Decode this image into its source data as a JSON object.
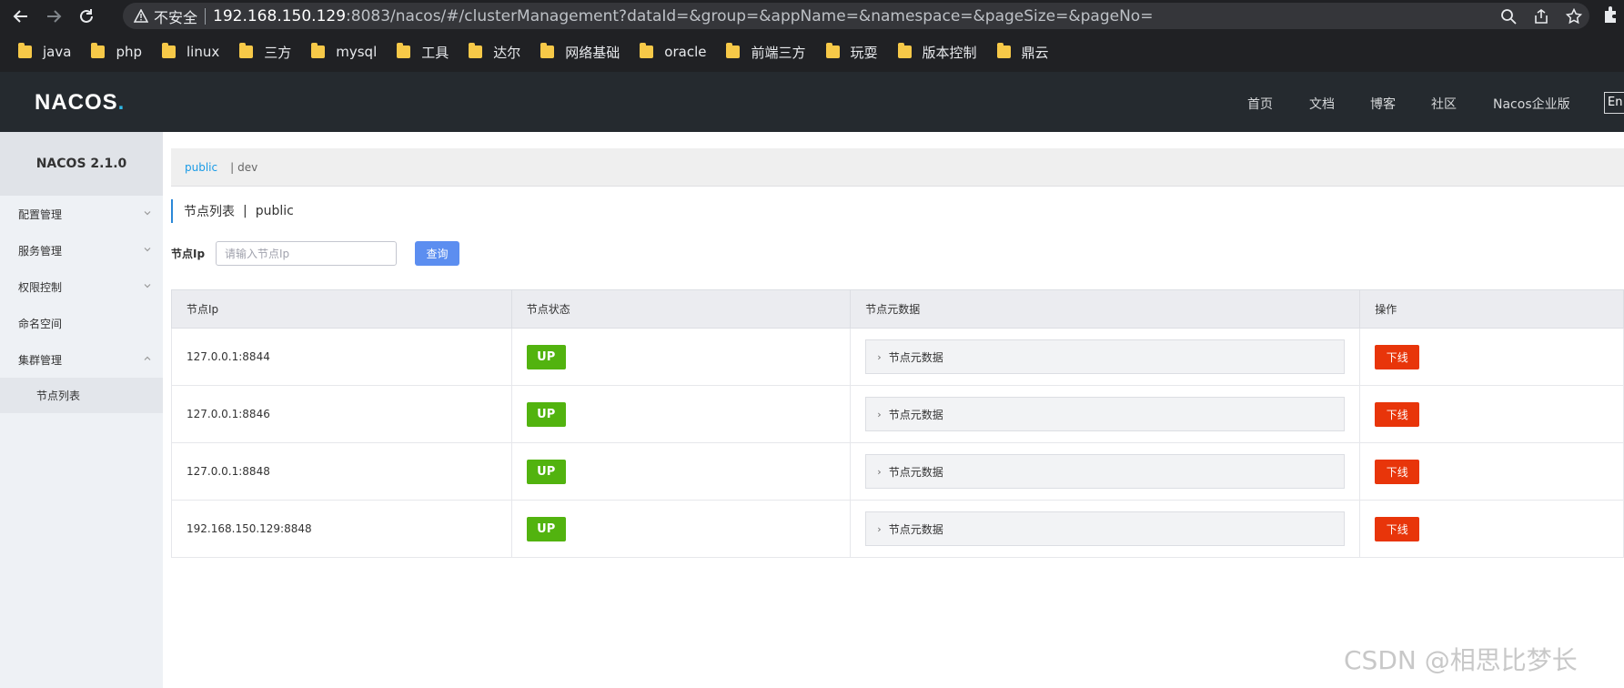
{
  "browser": {
    "insecure_label": "不安全",
    "url_host": "192.168.150.129",
    "url_rest": ":8083/nacos/#/clusterManagement?dataId=&group=&appName=&namespace=&pageSize=&pageNo=",
    "bookmarks": [
      "java",
      "php",
      "linux",
      "三方",
      "mysql",
      "工具",
      "达尔",
      "网络基础",
      "oracle",
      "前端三方",
      "玩耍",
      "版本控制",
      "鼎云"
    ]
  },
  "header": {
    "logo_main": "NACOS",
    "logo_dot": ".",
    "nav": [
      "首页",
      "文档",
      "博客",
      "社区",
      "Nacos企业版"
    ],
    "lang": "En"
  },
  "sidebar": {
    "version": "NACOS 2.1.0",
    "items": [
      {
        "label": "配置管理",
        "chevron": "down"
      },
      {
        "label": "服务管理",
        "chevron": "down"
      },
      {
        "label": "权限控制",
        "chevron": "down"
      },
      {
        "label": "命名空间",
        "chevron": ""
      },
      {
        "label": "集群管理",
        "chevron": "up"
      }
    ],
    "sub_item": "节点列表"
  },
  "namespace": {
    "active": "public",
    "other": "dev"
  },
  "page": {
    "title": "节点列表",
    "separator": "|",
    "namespace": "public"
  },
  "filter": {
    "label": "节点Ip",
    "placeholder": "请输入节点Ip",
    "value": "",
    "query_label": "查询"
  },
  "table": {
    "headers": [
      "节点Ip",
      "节点状态",
      "节点元数据",
      "操作"
    ],
    "rows": [
      {
        "ip": "127.0.0.1:8844",
        "status": "UP",
        "meta": "节点元数据",
        "action": "下线"
      },
      {
        "ip": "127.0.0.1:8846",
        "status": "UP",
        "meta": "节点元数据",
        "action": "下线"
      },
      {
        "ip": "127.0.0.1:8848",
        "status": "UP",
        "meta": "节点元数据",
        "action": "下线"
      },
      {
        "ip": "192.168.150.129:8848",
        "status": "UP",
        "meta": "节点元数据",
        "action": "下线"
      }
    ]
  },
  "watermark": "CSDN @相思比梦长",
  "colors": {
    "header_bg": "#252a2f",
    "status_up": "#52b30f",
    "offline_btn": "#e8350a",
    "query_btn": "#5c8ef0",
    "link_active": "#1a9be6"
  }
}
